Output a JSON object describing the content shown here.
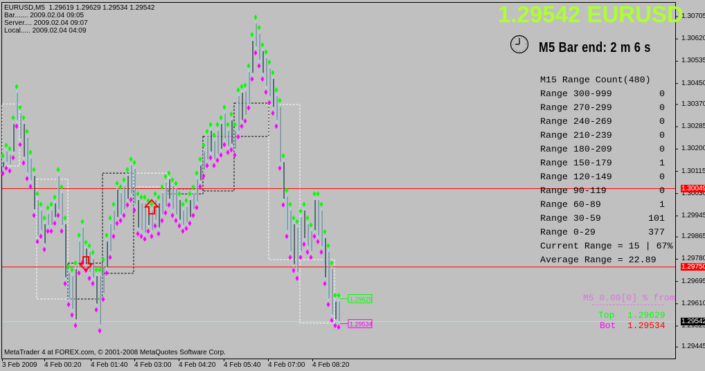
{
  "header": {
    "symbol_line": "EURUSD,M5  1.29619 1.29629 1.29534 1.29542",
    "bar_time": "Bar....... 2009.02.04 09:05",
    "server_time": "Server.... 2009.02.04 09:07",
    "local_time": "Local..... 2009.02.04 04:09"
  },
  "big_price": "1.29542 EURUSD",
  "bar_end": {
    "icon": "clock-icon",
    "text": "M5 Bar end: 2 m 6 s"
  },
  "range_panel": {
    "title": "M15 Range Count(480)",
    "rows": [
      {
        "label": "Range 300-999",
        "count": "0"
      },
      {
        "label": "Range 270-299",
        "count": "0"
      },
      {
        "label": "Range 240-269",
        "count": "0"
      },
      {
        "label": "Range 210-239",
        "count": "0"
      },
      {
        "label": "Range 180-209",
        "count": "0"
      },
      {
        "label": "Range 150-179",
        "count": "1"
      },
      {
        "label": "Range 120-149",
        "count": "0"
      },
      {
        "label": "Range 90-119",
        "count": "0"
      },
      {
        "label": "Range 60-89",
        "count": "1"
      },
      {
        "label": "Range 30-59",
        "count": "101"
      },
      {
        "label": "Range 0-29",
        "count": "377"
      }
    ],
    "current_range": "Current Range = 15 | 67%",
    "average_range": "Average Range = 22.89"
  },
  "m5_panel": {
    "title": "M5 0.00[0] % from",
    "top_label": "Top",
    "top_value": "1.29629",
    "bot_label": "Bot",
    "bot_value": "1.29534"
  },
  "footer": {
    "copyright": "MetaTrader 4 at FOREX.com, © 2001-2008 MetaQuotes Software Corp."
  },
  "colors": {
    "background": "#c0c0c0",
    "high_marker": "#00ff00",
    "low_marker": "#ff00ff",
    "bar_up": "#add8e6",
    "bar_down": "#000000",
    "hline": "#ff0000",
    "bid_line": "#7fffd4",
    "big_price": "#adff2f"
  },
  "chart_data": {
    "type": "bar",
    "symbol": "EURUSD",
    "timeframe": "M5",
    "ylim": [
      1.29445,
      1.30705
    ],
    "price_ticks": [
      "1.30705",
      "1.30620",
      "1.30535",
      "1.30450",
      "1.30370",
      "1.30285",
      "1.30200",
      "1.30115",
      "1.30030",
      "1.29945",
      "1.29865",
      "1.29780",
      "1.29695",
      "1.29610",
      "1.29525",
      "1.29445"
    ],
    "time_ticks": [
      "3 Feb 2009",
      "4 Feb 00:20",
      "4 Feb 01:40",
      "4 Feb 03:00",
      "4 Feb 04:20",
      "4 Feb 05:40",
      "4 Feb 07:00",
      "4 Feb 08:20"
    ],
    "hlines": [
      {
        "price": 1.30049,
        "label": "1.30049"
      },
      {
        "price": 1.2975,
        "label": "1.29750"
      }
    ],
    "bid": {
      "price": 1.29542,
      "label": "1.29542"
    },
    "highs": [
      1.30161,
      1.30201,
      1.30188,
      1.30306,
      1.30425,
      1.30346,
      1.30306,
      1.30254,
      1.30174,
      1.30108,
      1.30016,
      1.29976,
      1.29924,
      1.29963,
      1.29976,
      1.30003,
      1.30108,
      1.30042,
      1.29924,
      1.29739,
      1.29726,
      1.29752,
      1.29858,
      1.2991,
      1.29831,
      1.29818,
      1.29792,
      1.29726,
      1.29726,
      1.29765,
      1.29858,
      1.29924,
      1.29976,
      1.30056,
      1.30042,
      1.30069,
      1.30108,
      1.30148,
      1.30135,
      1.30016,
      1.30003,
      1.30003,
      1.2999,
      1.29976,
      1.30016,
      1.30003,
      1.30042,
      1.30082,
      1.30095,
      1.30069,
      1.30056,
      1.30016,
      1.29976,
      1.2999,
      1.30016,
      1.30042,
      1.30095,
      1.30148,
      1.30201,
      1.30254,
      1.3028,
      1.3024,
      1.3028,
      1.30306,
      1.30346,
      1.3028,
      1.3032,
      1.3028,
      1.30412,
      1.30425,
      1.3043,
      1.30504,
      1.30623,
      1.30689,
      1.3065,
      1.30584,
      1.30557,
      1.30518,
      1.30478,
      1.30412,
      1.30372,
      1.30161,
      1.30029,
      1.29976,
      1.29924,
      1.2991,
      1.2995,
      1.29976,
      1.29924,
      1.29897,
      1.30016,
      1.30016,
      1.29976,
      1.29871,
      1.29818,
      1.29752,
      1.29629,
      1.29629
    ],
    "lows": [
      1.3012,
      1.3014,
      1.3013,
      1.3018,
      1.303,
      1.3023,
      1.3016,
      1.301,
      1.3007,
      1.2996,
      1.2986,
      1.2988,
      1.2983,
      1.299,
      1.299,
      1.2993,
      1.2996,
      1.299,
      1.297,
      1.2962,
      1.2958,
      1.2954,
      1.2974,
      1.2978,
      1.2975,
      1.2972,
      1.297,
      1.296,
      1.2952,
      1.2964,
      1.2974,
      1.298,
      1.2988,
      1.2993,
      1.2994,
      1.2996,
      1.3,
      1.3002,
      1.2998,
      1.2989,
      1.2988,
      1.2987,
      1.299,
      1.2988,
      1.2992,
      1.2989,
      1.2994,
      1.2997,
      1.3,
      1.2996,
      1.2994,
      1.2992,
      1.299,
      1.2991,
      1.2993,
      1.2996,
      1.2999,
      1.3007,
      1.3011,
      1.3015,
      1.3018,
      1.3015,
      1.3017,
      1.3019,
      1.3023,
      1.302,
      1.3021,
      1.3019,
      1.3026,
      1.303,
      1.3032,
      1.3037,
      1.3048,
      1.3058,
      1.3053,
      1.3048,
      1.3043,
      1.3039,
      1.3035,
      1.303,
      1.3014,
      1.3,
      1.2988,
      1.298,
      1.2975,
      1.2972,
      1.298,
      1.2985,
      1.2982,
      1.298,
      1.2988,
      1.2986,
      1.2982,
      1.297,
      1.2962,
      1.2956,
      1.2954,
      1.29534
    ],
    "range_boxes": [
      {
        "color": "white",
        "from_bar": 0,
        "to_bar": 5,
        "top": 1.30372,
        "bottom": 1.30135
      },
      {
        "color": "white",
        "from_bar": 10,
        "to_bar": 19,
        "top": 1.30085,
        "bottom": 1.29628
      },
      {
        "color": "black",
        "from_bar": 19,
        "to_bar": 29,
        "top": 1.29765,
        "bottom": 1.29628
      },
      {
        "color": "black",
        "from_bar": 29,
        "to_bar": 38,
        "top": 1.30108,
        "bottom": 1.29726
      },
      {
        "color": "white",
        "from_bar": 38,
        "to_bar": 48,
        "top": 1.30108,
        "bottom": 1.30056
      },
      {
        "color": "black",
        "from_bar": 48,
        "to_bar": 58,
        "top": 1.30048,
        "bottom": 1.30029
      },
      {
        "color": "black",
        "from_bar": 58,
        "to_bar": 67,
        "top": 1.30248,
        "bottom": 1.3004
      },
      {
        "color": "black",
        "from_bar": 67,
        "to_bar": 77,
        "top": 1.30375,
        "bottom": 1.30248
      },
      {
        "color": "white",
        "from_bar": 77,
        "to_bar": 86,
        "top": 1.3037,
        "bottom": 1.29778
      },
      {
        "color": "white",
        "from_bar": 86,
        "to_bar": 96,
        "top": 1.29778,
        "bottom": 1.29536
      }
    ],
    "arrows": [
      {
        "direction": "down",
        "bar": 24,
        "price": 1.29752
      },
      {
        "direction": "up",
        "bar": 43,
        "price": 1.2999
      }
    ],
    "price_labels": [
      {
        "text": "1.29629",
        "bar": 97,
        "price": 1.29629,
        "color": "#00ff00"
      },
      {
        "text": "1.29534",
        "bar": 97,
        "price": 1.29534,
        "color": "#ff00ff"
      }
    ]
  }
}
